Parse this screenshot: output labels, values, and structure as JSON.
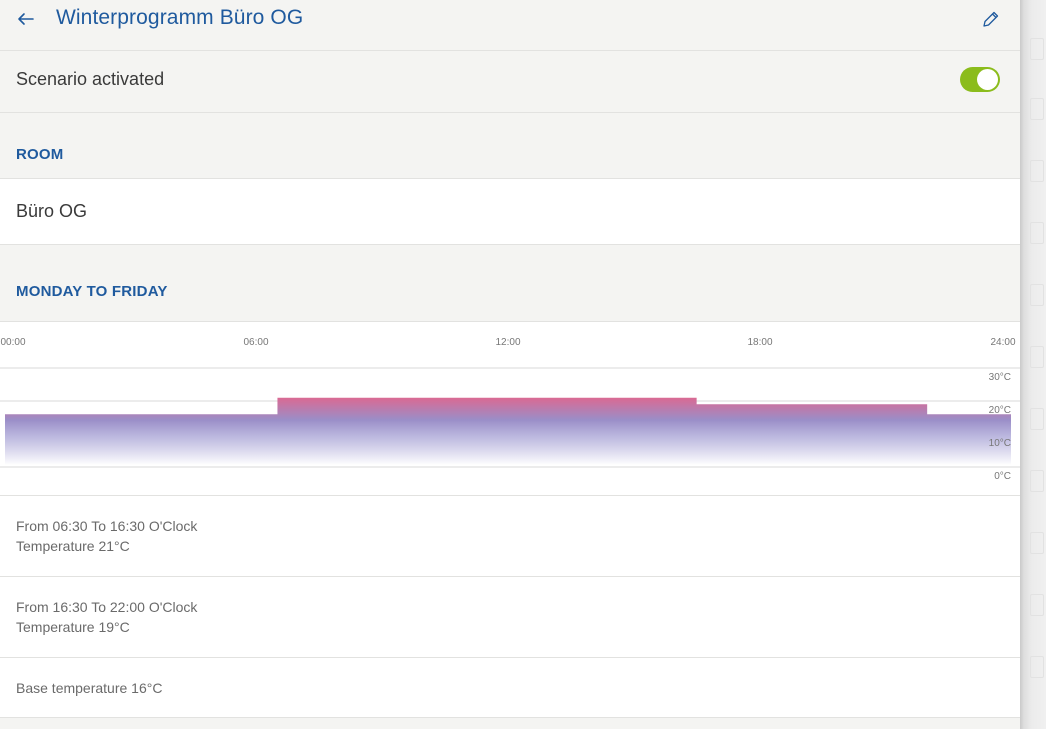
{
  "header": {
    "title": "Winterprogramm Büro OG",
    "back_icon": "arrow-left-icon",
    "edit_icon": "pencil-icon"
  },
  "scenario": {
    "label": "Scenario activated",
    "active": true,
    "toggle_color": "#8bbc1c"
  },
  "room_section": {
    "heading": "ROOM",
    "value": "Büro OG"
  },
  "schedule_section": {
    "heading": "MONDAY TO FRIDAY"
  },
  "chart_data": {
    "type": "area",
    "x_ticks": [
      "00:00",
      "06:00",
      "12:00",
      "18:00",
      "24:00"
    ],
    "y_ticks": [
      "30°C",
      "20°C",
      "10°C",
      "0°C"
    ],
    "x_range_hours": [
      0,
      24
    ],
    "y_range_celsius": [
      0,
      30
    ],
    "base_temperature": 16,
    "segments": [
      {
        "from": 0,
        "to": 6.5,
        "temperature": 16
      },
      {
        "from": 6.5,
        "to": 16.5,
        "temperature": 21
      },
      {
        "from": 16.5,
        "to": 22,
        "temperature": 19
      },
      {
        "from": 22,
        "to": 24,
        "temperature": 16
      }
    ],
    "colors": {
      "warm": "#e0668e",
      "mid": "#9a8ec8",
      "cool": "#ffffff"
    }
  },
  "entries": [
    {
      "line1": "From 06:30 To 16:30 O'Clock",
      "line2": "Temperature 21°C"
    },
    {
      "line1": "From 16:30 To 22:00 O'Clock",
      "line2": "Temperature 19°C"
    },
    {
      "line1": "Base temperature 16°C"
    }
  ]
}
